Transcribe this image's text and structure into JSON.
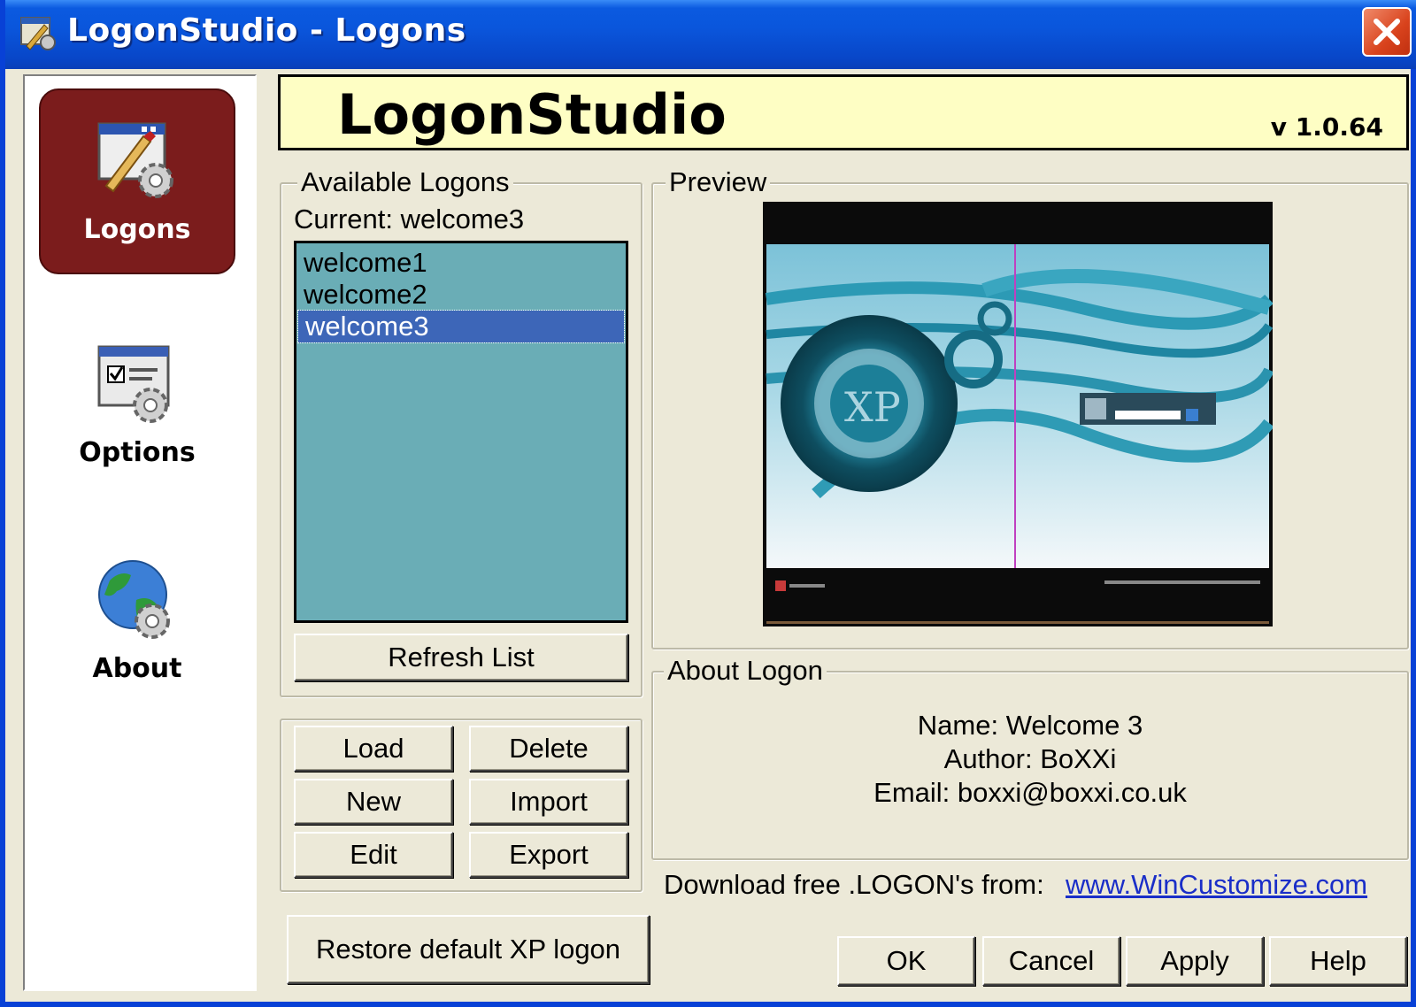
{
  "window": {
    "title": "LogonStudio - Logons"
  },
  "sidebar": {
    "items": [
      {
        "label": "Logons",
        "icon": "logon-gear-icon",
        "active": true
      },
      {
        "label": "Options",
        "icon": "options-gear-icon",
        "active": false
      },
      {
        "label": "About",
        "icon": "globe-gear-icon",
        "active": false
      }
    ]
  },
  "header": {
    "title": "LogonStudio",
    "version": "v 1.0.64"
  },
  "available": {
    "legend": "Available Logons",
    "current": "Current: welcome3",
    "items": [
      "welcome1",
      "welcome2",
      "welcome3"
    ],
    "selected_index": 2,
    "refresh_label": "Refresh List"
  },
  "actions": {
    "load": "Load",
    "delete": "Delete",
    "new": "New",
    "import": "Import",
    "edit": "Edit",
    "export": "Export"
  },
  "restore_label": "Restore default XP logon",
  "preview": {
    "legend": "Preview"
  },
  "about_logon": {
    "legend": "About Logon",
    "name": "Name: Welcome 3",
    "author": "Author: BoXXi",
    "email": "Email: boxxi@boxxi.co.uk"
  },
  "download": {
    "text": "Download free .LOGON's from:",
    "link": "www.WinCustomize.com"
  },
  "dialog_buttons": {
    "ok": "OK",
    "cancel": "Cancel",
    "apply": "Apply",
    "help": "Help"
  },
  "colors": {
    "titlebar": "#0a56dc",
    "accent_active": "#7b1c1c",
    "header_bg": "#fefec4",
    "list_bg": "#6aadb6",
    "selection": "#3d66b8",
    "link": "#1a2ec8"
  }
}
